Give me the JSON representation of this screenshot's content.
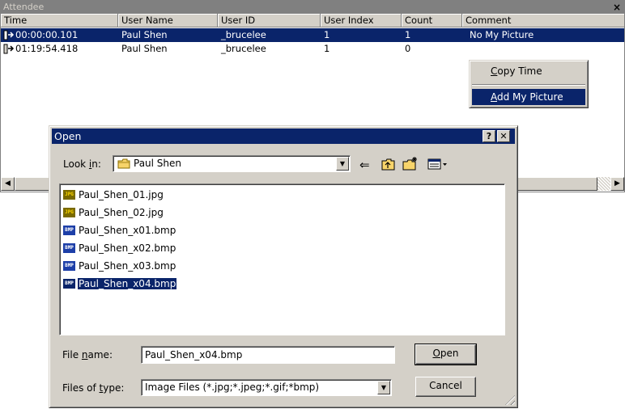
{
  "attendee": {
    "title": "Attendee",
    "close": "×",
    "columns": [
      "Time",
      "User Name",
      "User ID",
      "User Index",
      "Count",
      "Comment"
    ],
    "rows": [
      {
        "time": "00:00:00.101",
        "user_name": "Paul Shen",
        "user_id": "_brucelee",
        "user_index": "1",
        "count": "1",
        "comment": "No My Picture",
        "selected": true
      },
      {
        "time": "01:19:54.418",
        "user_name": "Paul Shen",
        "user_id": "_brucelee",
        "user_index": "1",
        "count": "0",
        "comment": "",
        "selected": false
      }
    ],
    "scroll_left": "◀",
    "scroll_right": "▶"
  },
  "context_menu": {
    "items": [
      {
        "label": "Copy Time",
        "mnemonic": "C",
        "rest": "opy Time"
      },
      {
        "label": "Add My Picture",
        "mnemonic": "A",
        "rest": "dd My Picture",
        "highlighted": true
      }
    ]
  },
  "open_dialog": {
    "title": "Open",
    "help_button": "?",
    "close_button": "✕",
    "look_in_label_pre": "Look ",
    "look_in_label_mn": "i",
    "look_in_label_post": "n:",
    "look_in_value": "Paul Shen",
    "files": [
      {
        "name": "Paul_Shen_01.jpg",
        "type": "jpg",
        "icon": "jpg-file-icon",
        "icon_text": "JPG"
      },
      {
        "name": "Paul_Shen_02.jpg",
        "type": "jpg",
        "icon": "jpg-file-icon",
        "icon_text": "JPG"
      },
      {
        "name": "Paul_Shen_x01.bmp",
        "type": "bmp",
        "icon": "bmp-file-icon",
        "icon_text": "BMP"
      },
      {
        "name": "Paul_Shen_x02.bmp",
        "type": "bmp",
        "icon": "bmp-file-icon",
        "icon_text": "BMP"
      },
      {
        "name": "Paul_Shen_x03.bmp",
        "type": "bmp",
        "icon": "bmp-file-icon",
        "icon_text": "BMP"
      },
      {
        "name": "Paul_Shen_x04.bmp",
        "type": "bmp",
        "icon": "bmp-file-icon",
        "icon_text": "BMP",
        "selected": true
      }
    ],
    "file_name_label_pre": "File ",
    "file_name_label_mn": "n",
    "file_name_label_post": "ame:",
    "file_name_value": "Paul_Shen_x04.bmp",
    "file_type_label_pre": "Files of ",
    "file_type_label_mn": "t",
    "file_type_label_post": "ype:",
    "file_type_value": "Image Files (*.jpg;*.jpeg;*.gif;*bmp)",
    "open_button_mn": "O",
    "open_button_rest": "pen",
    "cancel_button": "Cancel"
  },
  "colors": {
    "selection": "#0a246a",
    "face": "#d4d0c8",
    "panel_title_bg": "#808080"
  }
}
